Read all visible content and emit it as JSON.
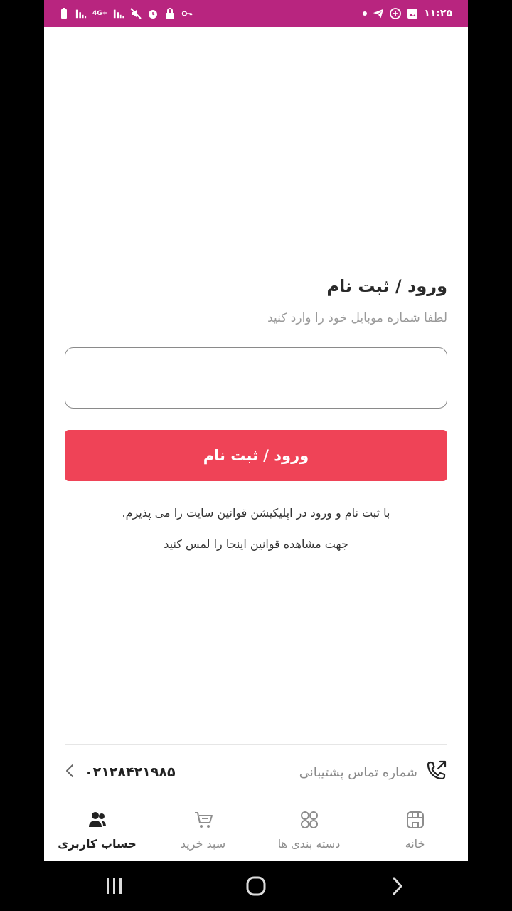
{
  "status_bar": {
    "time": "۱۱:۲۵",
    "network": "4G+"
  },
  "login": {
    "title": "ورود / ثبت نام",
    "subtitle": "لطفا شماره موبایل خود را وارد کنید",
    "phone_value": "",
    "submit_label": "ورود / ثبت نام",
    "terms_line1": "با ثبت نام و ورود در اپلیکیشن قوانین سایت را می پذیرم.",
    "terms_line2": "جهت مشاهده قوانین اینجا را لمس کنید"
  },
  "support": {
    "label": "شماره تماس پشتیبانی",
    "phone": "۰۲۱۲۸۴۲۱۹۸۵"
  },
  "bottom_nav": {
    "items": [
      {
        "label": "خانه",
        "icon": "home-icon"
      },
      {
        "label": "دسته بندی ها",
        "icon": "categories-icon"
      },
      {
        "label": "سبد خرید",
        "icon": "cart-icon"
      },
      {
        "label": "حساب کاربری",
        "icon": "users-icon"
      }
    ],
    "active_index": 3
  },
  "colors": {
    "status_bar": "#b8257f",
    "primary_button": "#ef4357"
  }
}
